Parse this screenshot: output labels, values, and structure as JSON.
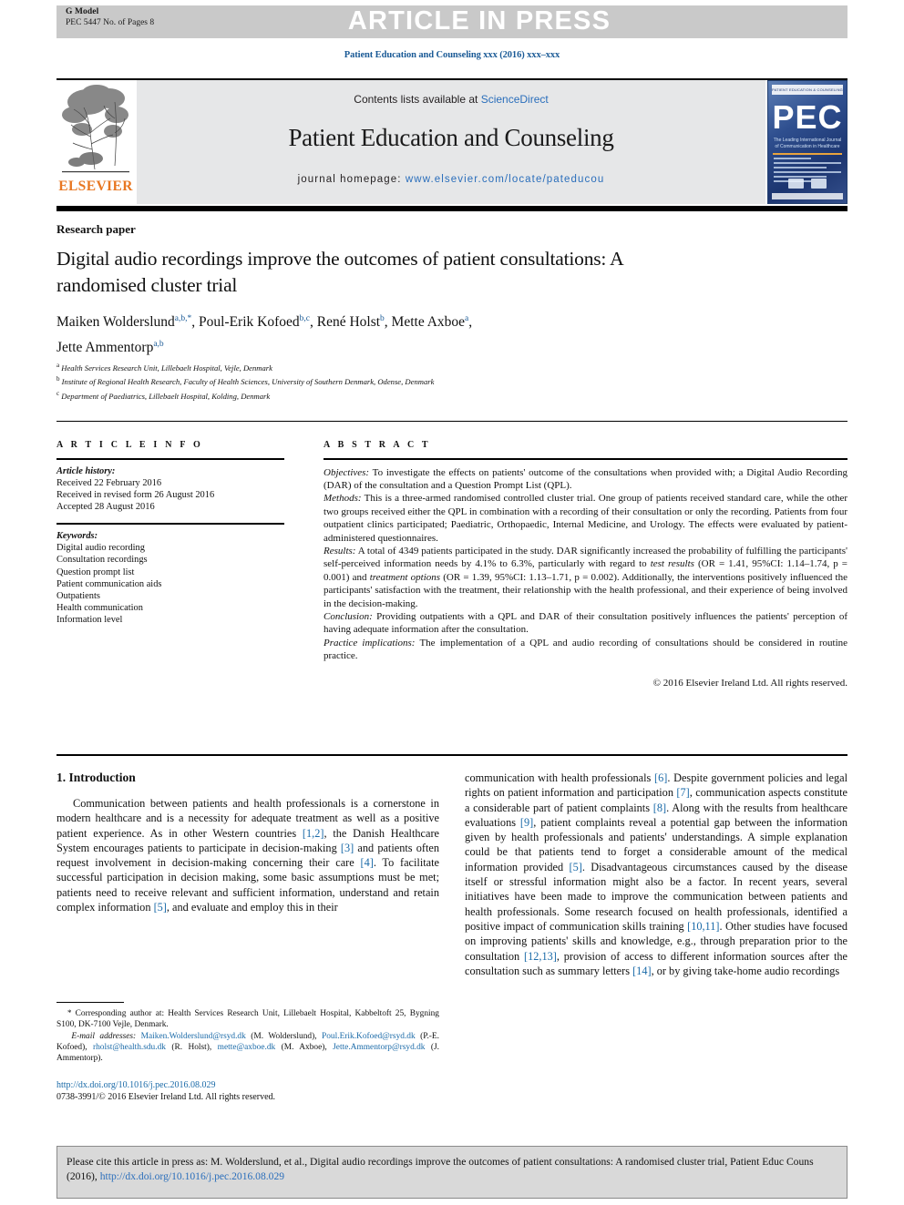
{
  "banner": {
    "g_model": "G Model",
    "pages_line": "PEC 5447 No. of Pages 8",
    "article_in_press": "ARTICLE IN PRESS"
  },
  "journal_ref": "Patient Education and Counseling xxx (2016) xxx–xxx",
  "masthead": {
    "contents_prefix": "Contents lists available at ",
    "sciencedirect": "ScienceDirect",
    "journal_name": "Patient Education and Counseling",
    "homepage_prefix": "journal homepage: ",
    "homepage_url": "www.elsevier.com/locate/pateducou",
    "elsevier_wordmark": "ELSEVIER",
    "pec_cover": {
      "top_bar": "PATIENT EDUCATION & COUNSELING",
      "acronym": "PEC",
      "subtitle": "The Leading International Journal of Communication in Healthcare"
    }
  },
  "article": {
    "type": "Research paper",
    "title": "Digital audio recordings improve the outcomes of patient consultations: A randomised cluster trial",
    "authors_line1_parts": [
      {
        "name": "Maiken Wolderslund",
        "sup": "a,b,*"
      },
      {
        "name": "Poul-Erik Kofoed",
        "sup": "b,c"
      },
      {
        "name": "René Holst",
        "sup": "b"
      },
      {
        "name": "Mette Axboe",
        "sup": "a"
      }
    ],
    "authors_line2": {
      "name": "Jette Ammentorp",
      "sup": "a,b"
    },
    "affiliations": [
      {
        "label": "a",
        "text": "Health Services Research Unit, Lillebaelt Hospital, Vejle, Denmark"
      },
      {
        "label": "b",
        "text": "Institute of Regional Health Research, Faculty of Health Sciences, University of Southern Denmark, Odense, Denmark"
      },
      {
        "label": "c",
        "text": "Department of Paediatrics, Lillebaelt Hospital, Kolding, Denmark"
      }
    ]
  },
  "article_info": {
    "heading": "A R T I C L E   I N F O",
    "history_label": "Article history:",
    "history": [
      "Received 22 February 2016",
      "Received in revised form 26 August 2016",
      "Accepted 28 August 2016"
    ],
    "keywords_label": "Keywords:",
    "keywords": [
      "Digital audio recording",
      "Consultation recordings",
      "Question prompt list",
      "Patient communication aids",
      "Outpatients",
      "Health communication",
      "Information level"
    ]
  },
  "abstract": {
    "heading": "A B S T R A C T",
    "objectives_label": "Objectives:",
    "objectives_text": " To investigate the effects on patients' outcome of the consultations when provided with; a Digital Audio Recording (DAR) of the consultation and a Question Prompt List (QPL).",
    "methods_label": "Methods:",
    "methods_text": " This is a three-armed randomised controlled cluster trial. One group of patients received standard care, while the other two groups received either the QPL in combination with a recording of their consultation or only the recording. Patients from four outpatient clinics participated; Paediatric, Orthopaedic, Internal Medicine, and Urology. The effects were evaluated by patient-administered questionnaires.",
    "results_label": "Results:",
    "results_text_a": " A total of 4349 patients participated in the study. DAR significantly increased the probability of fulfilling the participants' self-perceived information needs by 4.1% to 6.3%, particularly with regard to ",
    "results_italic_1": "test results",
    "results_stat_1": " (OR = 1.41, 95%CI: 1.14–1.74, p = 0.001) and ",
    "results_italic_2": "treatment options",
    "results_stat_2": " (OR = 1.39, 95%CI: 1.13–1.71, p = 0.002). Additionally, the interventions positively influenced the participants' satisfaction with the treatment, their relationship with the health professional, and their experience of being involved in the decision-making.",
    "conclusion_label": "Conclusion:",
    "conclusion_text": " Providing outpatients with a QPL and DAR of their consultation positively influences the patients' perception of having adequate information after the consultation.",
    "practice_label": "Practice implications:",
    "practice_text": " The implementation of a QPL and audio recording of consultations should be considered in routine practice.",
    "copyright": "© 2016 Elsevier Ireland Ltd. All rights reserved."
  },
  "introduction": {
    "heading": "1. Introduction",
    "left_paragraph_parts": [
      {
        "t": "Communication between patients and health professionals is a cornerstone in modern healthcare and is a necessity for adequate treatment as well as a positive patient experience. As in other Western countries "
      },
      {
        "t": "[1,2]",
        "ref": true
      },
      {
        "t": ", the Danish Healthcare System encourages patients to participate in decision-making "
      },
      {
        "t": "[3]",
        "ref": true
      },
      {
        "t": " and patients often request involvement in decision-making concerning their care "
      },
      {
        "t": "[4]",
        "ref": true
      },
      {
        "t": ". To facilitate successful participation in decision making, some basic assumptions must be met; patients need to receive relevant and sufficient information, understand and retain complex information "
      },
      {
        "t": "[5]",
        "ref": true
      },
      {
        "t": ", and evaluate and employ this in their"
      }
    ],
    "right_paragraph_parts": [
      {
        "t": "communication with health professionals "
      },
      {
        "t": "[6]",
        "ref": true
      },
      {
        "t": ". Despite government policies and legal rights on patient information and participation "
      },
      {
        "t": "[7]",
        "ref": true
      },
      {
        "t": ", communication aspects constitute a considerable part of patient complaints "
      },
      {
        "t": "[8]",
        "ref": true
      },
      {
        "t": ". Along with the results from healthcare evaluations "
      },
      {
        "t": "[9]",
        "ref": true
      },
      {
        "t": ", patient complaints reveal a potential gap between the information given by health professionals and patients' understandings. A simple explanation could be that patients tend to forget a considerable amount of the medical information provided "
      },
      {
        "t": "[5]",
        "ref": true
      },
      {
        "t": ". Disadvantageous circumstances caused by the disease itself or stressful information might also be a factor. In recent years, several initiatives have been made to improve the communication between patients and health professionals. Some research focused on health professionals, identified a positive impact of communication skills training "
      },
      {
        "t": "[10,11]",
        "ref": true
      },
      {
        "t": ". Other studies have focused on improving patients' skills and knowledge, e.g., through preparation prior to the consultation "
      },
      {
        "t": "[12,13]",
        "ref": true
      },
      {
        "t": ", provision of access to different information sources after the consultation such as summary letters "
      },
      {
        "t": "[14]",
        "ref": true
      },
      {
        "t": ", or by giving take-home audio recordings"
      }
    ]
  },
  "footnotes": {
    "corresponding_marker": "*",
    "corresponding_text": " Corresponding author at: Health Services Research Unit, Lillebaelt Hospital, Kabbeltoft 25, Bygning S100, DK-7100 Vejle, Denmark.",
    "email_label": "E-mail addresses:",
    "emails": [
      {
        "address": "Maiken.Wolderslund@rsyd.dk",
        "owner": " (M. Wolderslund), "
      },
      {
        "address": "Poul.Erik.Kofoed@rsyd.dk",
        "owner": " (P.-E. Kofoed), "
      },
      {
        "address": "rholst@health.sdu.dk",
        "owner": " (R. Holst), "
      },
      {
        "address": "mette@axboe.dk",
        "owner": " (M. Axboe), "
      },
      {
        "address": "Jette.Ammentorp@rsyd.dk",
        "owner": " (J. Ammentorp)."
      }
    ]
  },
  "doi_block": {
    "doi_url": "http://dx.doi.org/10.1016/j.pec.2016.08.029",
    "issn_line": "0738-3991/© 2016 Elsevier Ireland Ltd. All rights reserved."
  },
  "cite_box": {
    "text_before": "Please cite this article in press as: M. Wolderslund, et al., Digital audio recordings improve the outcomes of patient consultations: A randomised cluster trial, Patient Educ Couns (2016), ",
    "link": "http://dx.doi.org/10.1016/j.pec.2016.08.029"
  },
  "colors": {
    "link_blue": "#2a6ebb",
    "ref_blue": "#1a6aa8",
    "elsevier_orange": "#e87722",
    "banner_grey": "#c9c9c9",
    "masthead_grey": "#e6e7e8",
    "cite_grey": "#d9d9d9"
  }
}
